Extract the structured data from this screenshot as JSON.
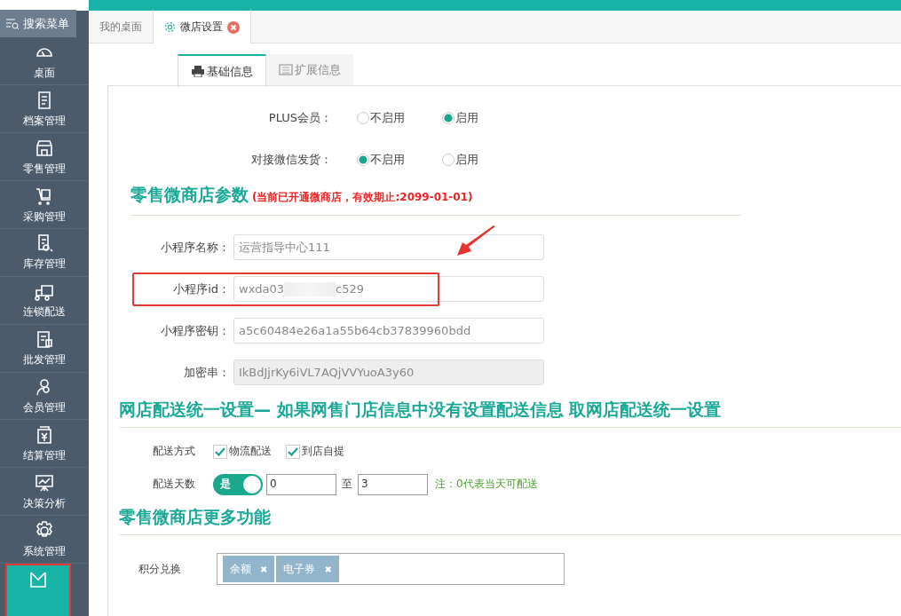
{
  "sidebar": {
    "search_button": "搜索菜单",
    "items": [
      {
        "label": "桌面",
        "selected": false
      },
      {
        "label": "档案管理",
        "selected": false
      },
      {
        "label": "零售管理",
        "selected": false
      },
      {
        "label": "采购管理",
        "selected": false
      },
      {
        "label": "库存管理",
        "selected": false
      },
      {
        "label": "连锁配送",
        "selected": false
      },
      {
        "label": "批发管理",
        "selected": false
      },
      {
        "label": "会员管理",
        "selected": false
      },
      {
        "label": "结算管理",
        "selected": false
      },
      {
        "label": "决策分析",
        "selected": false
      },
      {
        "label": "系统管理",
        "selected": false
      },
      {
        "selected": true
      }
    ]
  },
  "tabs": [
    {
      "label": "我的桌面",
      "selected": false,
      "closable": false
    },
    {
      "label": "微店设置",
      "selected": true,
      "closable": true
    }
  ],
  "subtabs": [
    {
      "label": "基础信息",
      "selected": true
    },
    {
      "label": "扩展信息",
      "selected": false
    }
  ],
  "radio_groups": [
    {
      "label": "PLUS会员：",
      "options": [
        {
          "label": "不启用",
          "selected": false
        },
        {
          "label": "启用",
          "selected": true
        }
      ]
    },
    {
      "label": "对接微信发货：",
      "options": [
        {
          "label": "不启用",
          "selected": true
        },
        {
          "label": "启用",
          "selected": false
        }
      ]
    }
  ],
  "shop_params": {
    "title": "零售微商店参数",
    "note": "(当前已开通微商店，有效期止:2099-01-01)",
    "fields": [
      {
        "label": "小程序名称：",
        "value": "运营指导中心111",
        "disabled": false,
        "highlighted": false
      },
      {
        "label": "小程序id：",
        "value": "wxda03",
        "value_end": "c529",
        "disabled": false,
        "highlighted": true
      },
      {
        "label": "小程序密钥：",
        "value": "a5c60484e26a1a55b64cb37839960bdd",
        "disabled": false,
        "highlighted": false
      },
      {
        "label": "加密串：",
        "value": "IkBdJjrKy6iVL7AQjVVYuoA3y60",
        "disabled": true,
        "highlighted": false
      }
    ]
  },
  "delivery": {
    "title": "网店配送统一设置— 如果网售门店信息中没有设置配送信息 取网店配送统一设置",
    "method_label": "配送方式",
    "methods": [
      {
        "label": "物流配送",
        "checked": true
      },
      {
        "label": "到店自提",
        "checked": true
      }
    ],
    "days_label": "配送天数",
    "switch": {
      "label": "是",
      "on": true
    },
    "from": "0",
    "to_label": "至",
    "to": "3",
    "note": "注：0代表当天可配送"
  },
  "more": {
    "title": "零售微商店更多功能",
    "points_label": "积分兑换",
    "tags": [
      "余额",
      "电子券"
    ],
    "tag_remove": "✖"
  }
}
